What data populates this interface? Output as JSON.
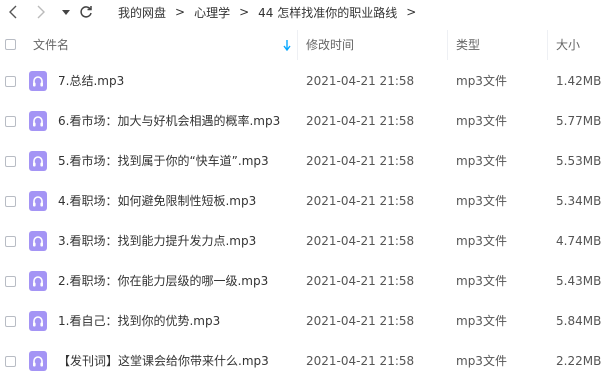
{
  "toolbar": {
    "icons": [
      "back-icon",
      "forward-icon",
      "dropdown-arrow-icon",
      "refresh-icon"
    ]
  },
  "breadcrumb": {
    "items": [
      "我的网盘",
      "心理学",
      "44 怎样找准你的职业路线"
    ],
    "separator": ">"
  },
  "header": {
    "name": "文件名",
    "time": "修改时间",
    "type": "类型",
    "size": "大小",
    "sort_icon": "sort-down-arrow-icon"
  },
  "colors": {
    "accent": "#06a7ff",
    "audio_icon_bg": "#a494f5"
  },
  "files": [
    {
      "name": "7.总结.mp3",
      "time": "2021-04-21 21:58",
      "type": "mp3文件",
      "size": "1.42MB",
      "icon": "audio-file-icon"
    },
    {
      "name": "6.看市场：加大与好机会相遇的概率.mp3",
      "time": "2021-04-21 21:58",
      "type": "mp3文件",
      "size": "5.77MB",
      "icon": "audio-file-icon"
    },
    {
      "name": "5.看市场：找到属于你的“快车道”.mp3",
      "time": "2021-04-21 21:58",
      "type": "mp3文件",
      "size": "5.53MB",
      "icon": "audio-file-icon"
    },
    {
      "name": "4.看职场：如何避免限制性短板.mp3",
      "time": "2021-04-21 21:58",
      "type": "mp3文件",
      "size": "5.34MB",
      "icon": "audio-file-icon"
    },
    {
      "name": "3.看职场：找到能力提升发力点.mp3",
      "time": "2021-04-21 21:58",
      "type": "mp3文件",
      "size": "4.74MB",
      "icon": "audio-file-icon"
    },
    {
      "name": "2.看职场：你在能力层级的哪一级.mp3",
      "time": "2021-04-21 21:58",
      "type": "mp3文件",
      "size": "5.43MB",
      "icon": "audio-file-icon"
    },
    {
      "name": "1.看自己：找到你的优势.mp3",
      "time": "2021-04-21 21:58",
      "type": "mp3文件",
      "size": "5.84MB",
      "icon": "audio-file-icon"
    },
    {
      "name": "【发刊词】这堂课会给你带来什么.mp3",
      "time": "2021-04-21 21:58",
      "type": "mp3文件",
      "size": "2.22MB",
      "icon": "audio-file-icon"
    }
  ]
}
